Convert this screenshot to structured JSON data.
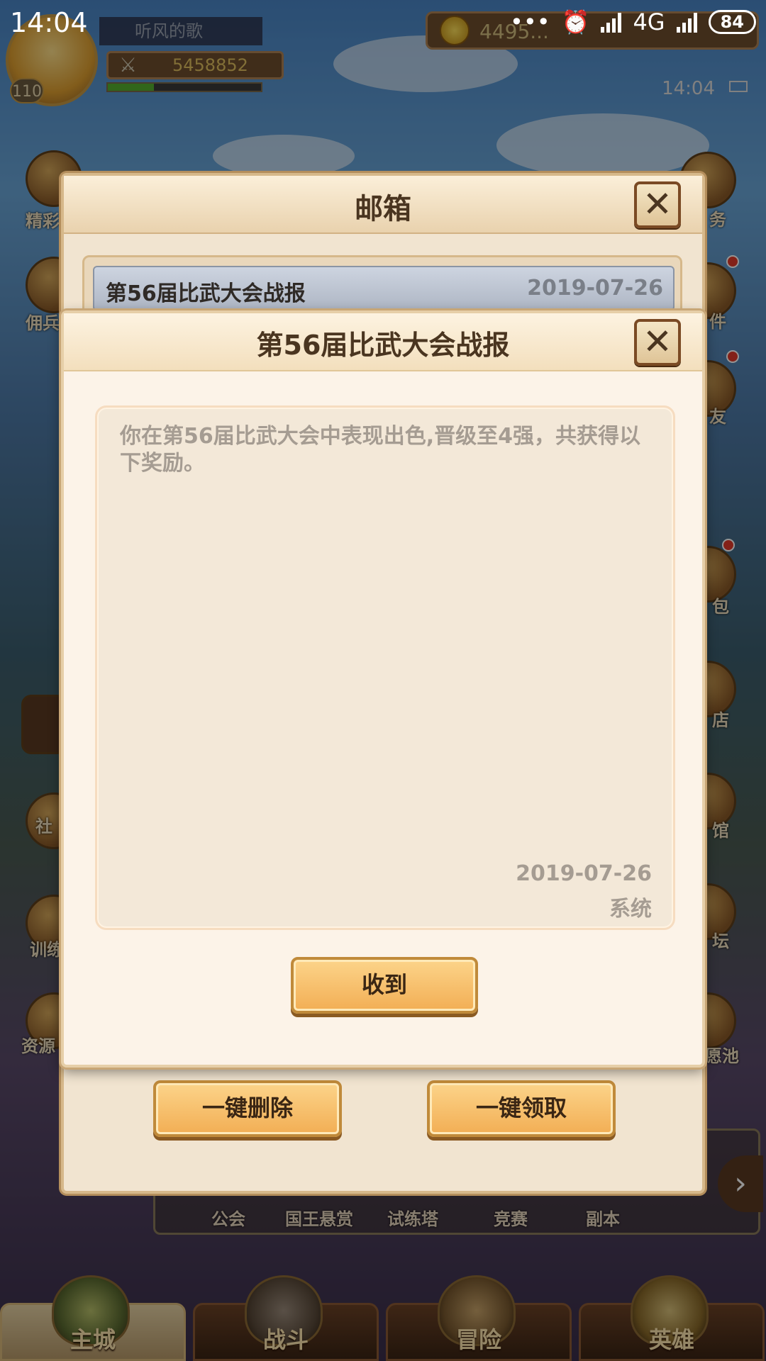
{
  "status_bar": {
    "time": "14:04",
    "network": "4G",
    "battery": "84"
  },
  "hud": {
    "player_name": "听风的歌",
    "level": "110",
    "power": "5458852",
    "xp_progress": 0.3,
    "currency_partial": "4495...",
    "clock": "14:04"
  },
  "side_left": [
    {
      "label": "精彩"
    },
    {
      "label": "佣兵"
    },
    {
      "label": "社"
    },
    {
      "label": "训练"
    },
    {
      "label": "资源"
    }
  ],
  "side_right": [
    {
      "label": "务"
    },
    {
      "label": "件"
    },
    {
      "label": "友"
    },
    {
      "label": "包"
    },
    {
      "label": "店"
    },
    {
      "label": "馆"
    },
    {
      "label": "坛"
    },
    {
      "label": "愿池"
    }
  ],
  "sub_menu": {
    "items": [
      {
        "label": "公会"
      },
      {
        "label": "国王悬赏"
      },
      {
        "label": "试练塔"
      },
      {
        "label": "竞赛"
      },
      {
        "label": "副本"
      }
    ]
  },
  "bottom_nav": {
    "tabs": [
      {
        "label": "主城",
        "active": true
      },
      {
        "label": "战斗",
        "active": false
      },
      {
        "label": "冒险",
        "active": false
      },
      {
        "label": "英雄",
        "active": false
      }
    ]
  },
  "mailbox": {
    "title": "邮箱",
    "items": [
      {
        "title": "第56届比武大会战报",
        "date": "2019-07-26"
      }
    ],
    "delete_all_label": "一键删除",
    "claim_all_label": "一键领取"
  },
  "mail_detail": {
    "title": "第56届比武大会战报",
    "body": "你在第56届比武大会中表现出色,晋级至4强，共获得以下奖励。",
    "date": "2019-07-26",
    "sender": "系统",
    "confirm_label": "收到"
  },
  "colors": {
    "button_orange": "#f2ae54",
    "panel_bg": "#fcf3e8",
    "title_brown": "#4a3520"
  }
}
